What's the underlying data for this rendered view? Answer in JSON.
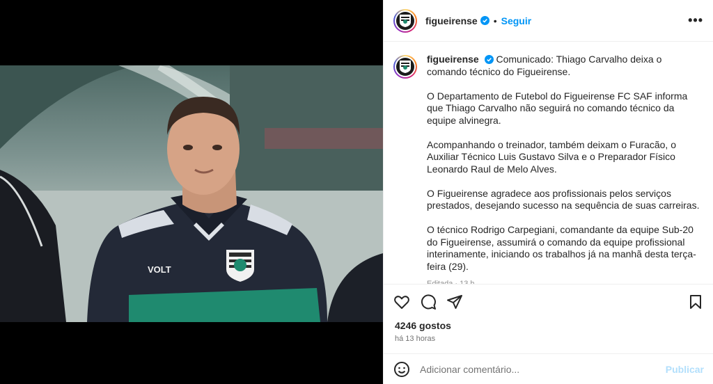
{
  "header": {
    "username": "figueirense",
    "separator": "•",
    "follow_label": "Seguir",
    "more_label": "•••"
  },
  "caption": {
    "username": "figueirense",
    "paragraphs": [
      "Comunicado: Thiago Carvalho deixa o comando técnico do Figueirense.",
      "O Departamento de Futebol do Figueirense FC SAF informa que Thiago Carvalho não seguirá no comando técnico da equipe alvinegra.",
      "Acompanhando o treinador, também deixam o Furacão, o Auxiliar Técnico Luis Gustavo Silva e o Preparador Físico Leonardo Raul de Melo Alves.",
      "O Figueirense agradece aos profissionais pelos serviços prestados, desejando sucesso na sequência de suas carreiras.",
      "O técnico Rodrigo Carpegiani, comandante da equipe Sub-20 do Figueirense, assumirá o comando da equipe profissional interinamente, iniciando os trabalhos já na manhã desta terça-feira (29)."
    ],
    "edited": "Editada · 13 h"
  },
  "photo": {
    "shirt_sponsor": "VOLT"
  },
  "stats": {
    "likes": "4246 gostos",
    "time_ago": "há 13 horas"
  },
  "comment": {
    "placeholder": "Adicionar comentário...",
    "publish_label": "Publicar"
  },
  "colors": {
    "accent": "#0095f6",
    "publish_disabled": "#b2dffc",
    "muted": "#737373"
  }
}
